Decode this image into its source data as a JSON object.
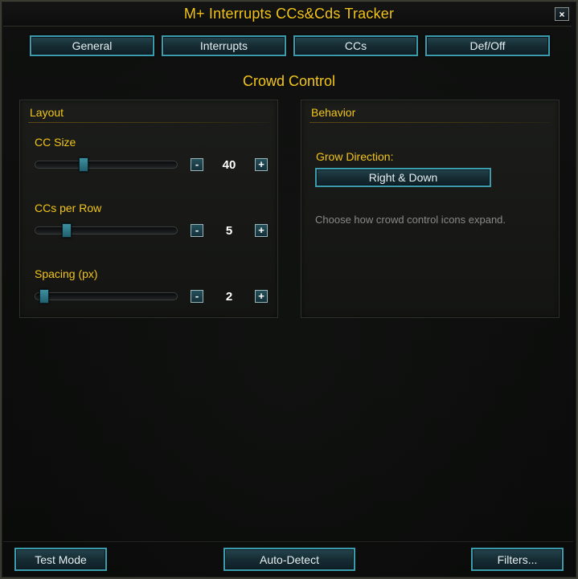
{
  "window": {
    "title": "M+ Interrupts CCs&Cds Tracker",
    "close_label": "×"
  },
  "tabs": [
    {
      "label": "General"
    },
    {
      "label": "Interrupts"
    },
    {
      "label": "CCs"
    },
    {
      "label": "Def/Off"
    }
  ],
  "section_title": "Crowd Control",
  "layout_panel": {
    "heading": "Layout",
    "cc_size": {
      "label": "CC Size",
      "value": "40",
      "minus": "-",
      "plus": "+"
    },
    "ccs_per_row": {
      "label": "CCs per Row",
      "value": "5",
      "minus": "-",
      "plus": "+"
    },
    "spacing": {
      "label": "Spacing (px)",
      "value": "2",
      "minus": "-",
      "plus": "+"
    }
  },
  "behavior_panel": {
    "heading": "Behavior",
    "grow_label": "Grow Direction:",
    "grow_value": "Right & Down",
    "help_text": "Choose how crowd control icons expand."
  },
  "footer": {
    "test_mode": "Test Mode",
    "auto_detect": "Auto-Detect",
    "filters": "Filters..."
  },
  "colors": {
    "accent_gold": "#f3c51a",
    "button_border": "#3a9cad",
    "background": "#0b0c0b"
  }
}
